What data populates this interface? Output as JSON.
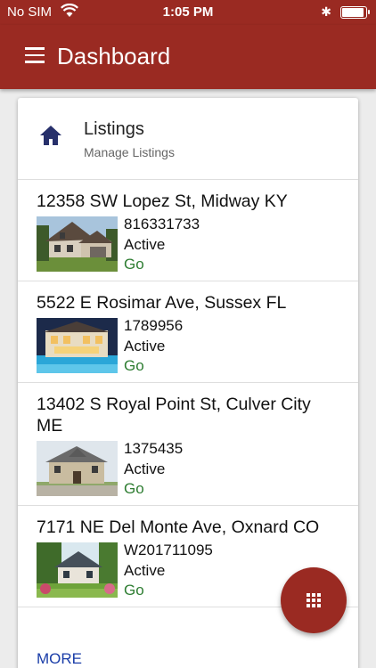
{
  "status_bar": {
    "carrier": "No SIM",
    "time": "1:05 PM"
  },
  "app_bar": {
    "title": "Dashboard"
  },
  "card": {
    "title": "Listings",
    "subtitle": "Manage Listings"
  },
  "listings": [
    {
      "address": "12358 SW Lopez St, Midway KY",
      "id": "816331733",
      "status": "Active",
      "action": "Go"
    },
    {
      "address": "5522 E Rosimar Ave, Sussex FL",
      "id": "1789956",
      "status": "Active",
      "action": "Go"
    },
    {
      "address": "13402 S Royal Point St, Culver City ME",
      "id": "1375435",
      "status": "Active",
      "action": "Go"
    },
    {
      "address": "7171 NE Del Monte Ave, Oxnard CO",
      "id": "W201711095",
      "status": "Active",
      "action": "Go"
    }
  ],
  "more_label": "MORE",
  "colors": {
    "primary": "#9a2a22",
    "link": "#1a3da8",
    "go": "#2e7d32",
    "home_icon": "#27306b"
  },
  "icons": {
    "menu": "hamburger-icon",
    "home": "home-icon",
    "fab": "grid-icon"
  }
}
